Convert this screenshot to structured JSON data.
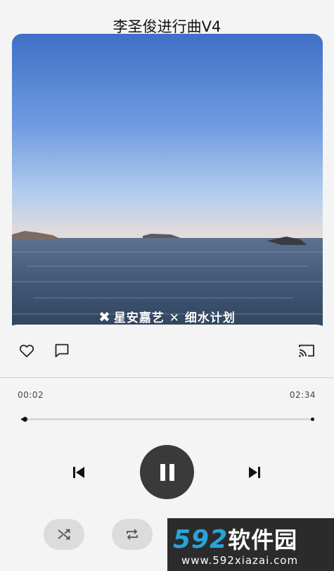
{
  "song": {
    "title": "李圣俊进行曲V4"
  },
  "cover": {
    "watermark_left": "星安嘉艺",
    "watermark_x": "✕",
    "watermark_right": "细水计划"
  },
  "player": {
    "current_time": "00:02",
    "total_time": "02:34",
    "progress_fraction": 0.013,
    "is_playing": true
  },
  "actions": {
    "like_icon": "heart-outline-icon",
    "comment_icon": "comment-icon",
    "cast_icon": "cast-icon",
    "previous_icon": "skip-previous-icon",
    "pause_icon": "pause-icon",
    "next_icon": "skip-next-icon",
    "shuffle_icon": "shuffle-icon",
    "repeat_icon": "repeat-icon"
  },
  "site_watermark": {
    "brand_num": "592",
    "brand_cn": "软件园",
    "url": "www.592xiazai.com"
  },
  "colors": {
    "background": "#f4f4f4",
    "play_button": "#3a3a3a",
    "pill_button": "#dcdcdc",
    "watermark_accent": "#2aa3d8"
  }
}
